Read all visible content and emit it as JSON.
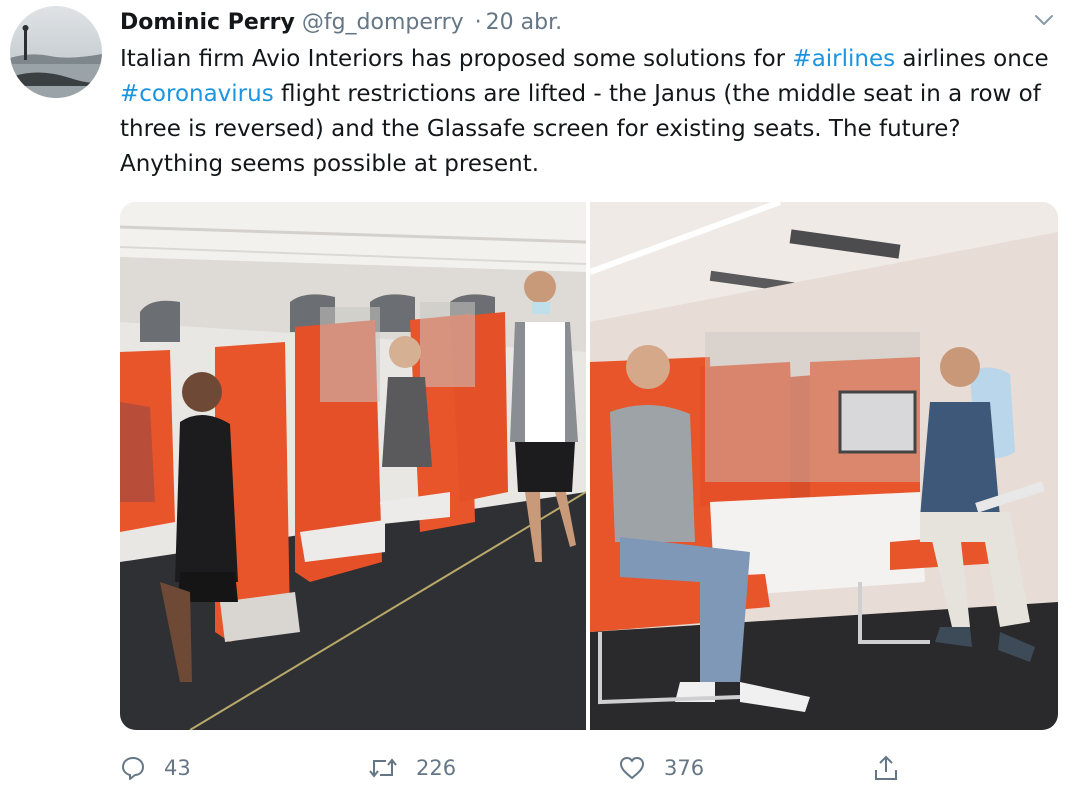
{
  "author": {
    "name": "Dominic Perry",
    "handle": "@fg_domperry",
    "separator": "·",
    "date": "20 abr."
  },
  "tweet": {
    "seg1": "Italian firm Avio Interiors has proposed some solutions for ",
    "hashtag1": "#airlines",
    "seg2": " airlines once ",
    "hashtag2": "#coronavirus",
    "seg3": " flight restrictions are lifted - the Janus (the middle seat in a row of three is reversed) and the Glassafe screen for existing seats. The future? Anything seems possible at present."
  },
  "actions": {
    "reply_count": "43",
    "retweet_count": "226",
    "like_count": "376",
    "icons": [
      "reply-icon",
      "retweet-icon",
      "like-icon",
      "share-icon"
    ]
  },
  "colors": {
    "hashtag": "#1b95e0",
    "secondary_text": "#657786",
    "seat_orange": "#e8552b"
  }
}
